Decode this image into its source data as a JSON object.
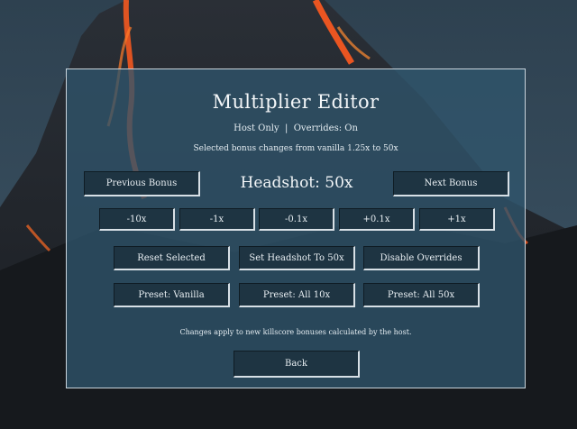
{
  "editor": {
    "title": "Multiplier Editor",
    "subtitle": "Host Only  |  Overrides: On",
    "info": "Selected bonus changes from vanilla 1.25x to 50x",
    "headshot_label": "Headshot: 50x",
    "footer_note": "Changes apply to new killscore bonuses calculated by the host."
  },
  "nav": {
    "previous_label": "Previous Bonus",
    "next_label": "Next Bonus"
  },
  "steps": [
    {
      "label": "-10x"
    },
    {
      "label": "-1x"
    },
    {
      "label": "-0.1x"
    },
    {
      "label": "+0.1x"
    },
    {
      "label": "+1x"
    }
  ],
  "actions": {
    "reset_selected": "Reset Selected",
    "set_headshot": "Set Headshot To 50x",
    "disable_overrides": "Disable Overrides"
  },
  "presets": {
    "vanilla": "Preset: Vanilla",
    "all10": "Preset: All 10x",
    "all50": "Preset: All 50x"
  },
  "back_label": "Back",
  "colors": {
    "panel": "#30546c",
    "button": "#1e3442",
    "lava": "#ff5a1f"
  }
}
